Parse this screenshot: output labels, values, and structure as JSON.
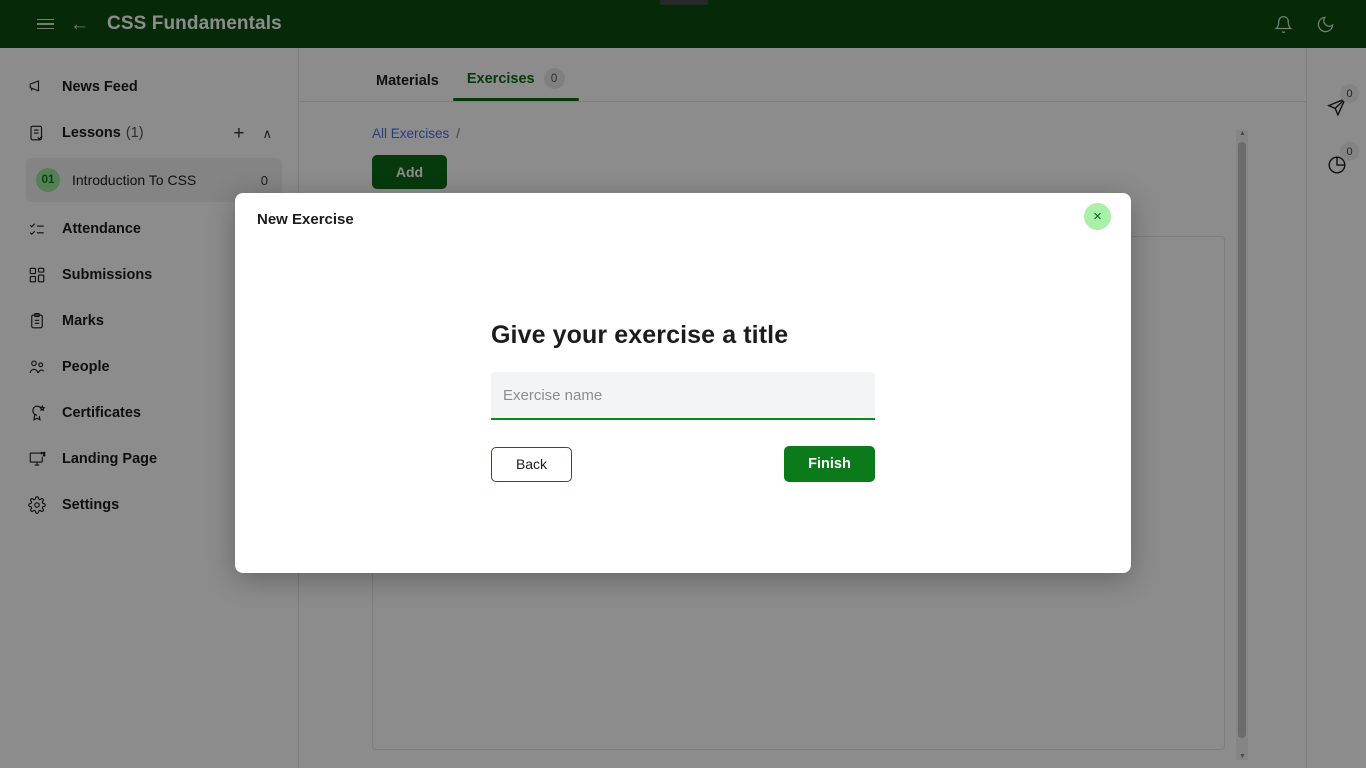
{
  "topbar": {
    "menu_icon": "hamburger-icon",
    "back_icon": "back-arrow-icon",
    "title": "CSS Fundamentals",
    "notifications_icon": "bell-icon",
    "theme_icon": "moon-icon"
  },
  "sidebar": {
    "items": [
      {
        "label": "News Feed",
        "icon": "megaphone-icon"
      },
      {
        "label": "Lessons",
        "count": "(1)",
        "icon": "lesson-list-icon",
        "add_label": "+",
        "collapse_label": "∧"
      },
      {
        "label": "Attendance",
        "icon": "checklist-icon"
      },
      {
        "label": "Submissions",
        "icon": "grid-icon"
      },
      {
        "label": "Marks",
        "icon": "clipboard-icon"
      },
      {
        "label": "People",
        "icon": "people-icon"
      },
      {
        "label": "Certificates",
        "icon": "certificate-icon"
      },
      {
        "label": "Landing Page",
        "icon": "monitor-icon"
      },
      {
        "label": "Settings",
        "icon": "gear-icon"
      }
    ],
    "lesson": {
      "number": "01",
      "name": "Introduction To CSS",
      "badge": "0"
    }
  },
  "main": {
    "tabs": [
      {
        "label": "Materials",
        "active": false,
        "badge": ""
      },
      {
        "label": "Exercises",
        "active": true,
        "badge": "0"
      }
    ],
    "breadcrumb": {
      "root": "All Exercises",
      "separator": "/"
    },
    "add_button": "Add"
  },
  "rightrail": {
    "items": [
      {
        "icon": "paper-plane-icon",
        "badge": "0"
      },
      {
        "icon": "pie-chart-icon",
        "badge": "0"
      }
    ]
  },
  "modal": {
    "title": "New Exercise",
    "close_label": "×",
    "heading": "Give your exercise a title",
    "input_value": "",
    "input_placeholder": "Exercise name",
    "back_label": "Back",
    "finish_label": "Finish"
  },
  "colors": {
    "brand_dark": "#0b4d10",
    "brand_green": "#0b6b16",
    "accent_green": "#0b8a1e",
    "badge_green": "#9be79b",
    "link_blue": "#4a6fe0"
  }
}
